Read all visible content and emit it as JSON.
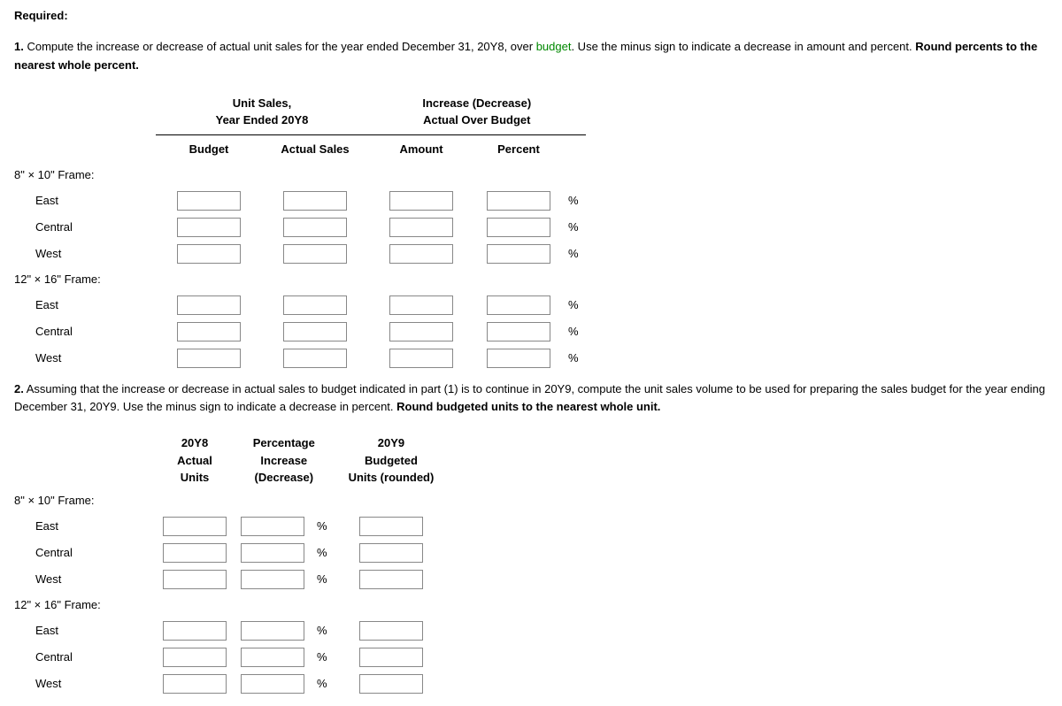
{
  "required_label": "Required:",
  "q1": {
    "num": "1.",
    "text_before": "Compute the increase or decrease of actual unit sales for the year ended December 31, 20Y8, over ",
    "link_text": "budget",
    "text_after": ". Use the minus sign to indicate a decrease in amount and percent. ",
    "bold_text": "Round percents to the nearest whole percent."
  },
  "t1": {
    "group1_l1": "Unit Sales,",
    "group1_l2": "Year Ended 20Y8",
    "group2_l1": "Increase (Decrease)",
    "group2_l2": "Actual Over Budget",
    "col_budget": "Budget",
    "col_actual": "Actual Sales",
    "col_amount": "Amount",
    "col_percent": "Percent",
    "pct_sym": "%"
  },
  "rows": {
    "frame1": "8\" × 10\" Frame:",
    "frame2": "12\" × 16\" Frame:",
    "east": "East",
    "central": "Central",
    "west": "West"
  },
  "q2": {
    "num": "2.",
    "text_before": "Assuming that the increase or decrease in actual sales to budget indicated in part (1) is to continue in 20Y9, compute the unit sales volume to be used for preparing the sales budget for the year ending December 31, 20Y9. Use the minus sign to indicate a decrease in percent. ",
    "bold_text": "Round budgeted units to the nearest whole unit."
  },
  "t2": {
    "c1_l1": "20Y8",
    "c1_l2": "Actual",
    "c1_l3": "Units",
    "c2_l1": "Percentage",
    "c2_l2": "Increase",
    "c2_l3": "(Decrease)",
    "c3_l1": "20Y9",
    "c3_l2": "Budgeted",
    "c3_l3": "Units (rounded)",
    "pct_sym": "%"
  }
}
